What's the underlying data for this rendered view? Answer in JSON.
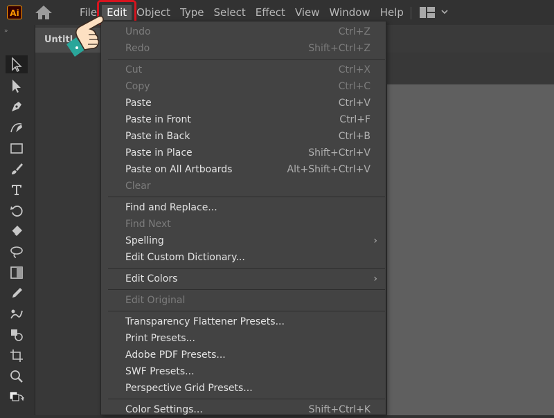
{
  "app": {
    "logo_text": "Ai",
    "document_tab": "Untitl"
  },
  "menubar": {
    "items": [
      "File",
      "Edit",
      "Object",
      "Type",
      "Select",
      "Effect",
      "View",
      "Window",
      "Help"
    ],
    "active_index": 1
  },
  "edit_menu": {
    "items": [
      {
        "label": "Undo",
        "shortcut": "Ctrl+Z",
        "enabled": false
      },
      {
        "label": "Redo",
        "shortcut": "Shift+Ctrl+Z",
        "enabled": false
      },
      {
        "label": "Cut",
        "shortcut": "Ctrl+X",
        "enabled": false
      },
      {
        "label": "Copy",
        "shortcut": "Ctrl+C",
        "enabled": false
      },
      {
        "label": "Paste",
        "shortcut": "Ctrl+V",
        "enabled": true
      },
      {
        "label": "Paste in Front",
        "shortcut": "Ctrl+F",
        "enabled": true
      },
      {
        "label": "Paste in Back",
        "shortcut": "Ctrl+B",
        "enabled": true
      },
      {
        "label": "Paste in Place",
        "shortcut": "Shift+Ctrl+V",
        "enabled": true
      },
      {
        "label": "Paste on All Artboards",
        "shortcut": "Alt+Shift+Ctrl+V",
        "enabled": true
      },
      {
        "label": "Clear",
        "shortcut": "",
        "enabled": false
      },
      {
        "label": "Find and Replace...",
        "shortcut": "",
        "enabled": true
      },
      {
        "label": "Find Next",
        "shortcut": "",
        "enabled": false
      },
      {
        "label": "Spelling",
        "shortcut": "",
        "enabled": true,
        "submenu": true
      },
      {
        "label": "Edit Custom Dictionary...",
        "shortcut": "",
        "enabled": true
      },
      {
        "label": "Edit Colors",
        "shortcut": "",
        "enabled": true,
        "submenu": true
      },
      {
        "label": "Edit Original",
        "shortcut": "",
        "enabled": false
      },
      {
        "label": "Transparency Flattener Presets...",
        "shortcut": "",
        "enabled": true
      },
      {
        "label": "Print Presets...",
        "shortcut": "",
        "enabled": true
      },
      {
        "label": "Adobe PDF Presets...",
        "shortcut": "",
        "enabled": true
      },
      {
        "label": "SWF Presets...",
        "shortcut": "",
        "enabled": true
      },
      {
        "label": "Perspective Grid Presets...",
        "shortcut": "",
        "enabled": true
      },
      {
        "label": "Color Settings...",
        "shortcut": "Shift+Ctrl+K",
        "enabled": true
      }
    ]
  },
  "icons": {
    "home": "home-icon",
    "workspace": "workspace-switcher-icon",
    "tools": [
      "selection-tool-icon",
      "direct-selection-tool-icon",
      "pen-tool-icon",
      "curvature-tool-icon",
      "rectangle-tool-icon",
      "paintbrush-tool-icon",
      "type-tool-icon",
      "rotate-tool-icon",
      "eraser-tool-icon",
      "lasso-tool-icon",
      "gradient-tool-icon",
      "eyedropper-tool-icon",
      "blend-tool-icon",
      "shape-builder-tool-icon",
      "artboard-tool-icon",
      "zoom-tool-icon",
      "fill-stroke-icon"
    ]
  },
  "colors": {
    "highlight": "#d7141e",
    "logo": "#ff9a00"
  }
}
